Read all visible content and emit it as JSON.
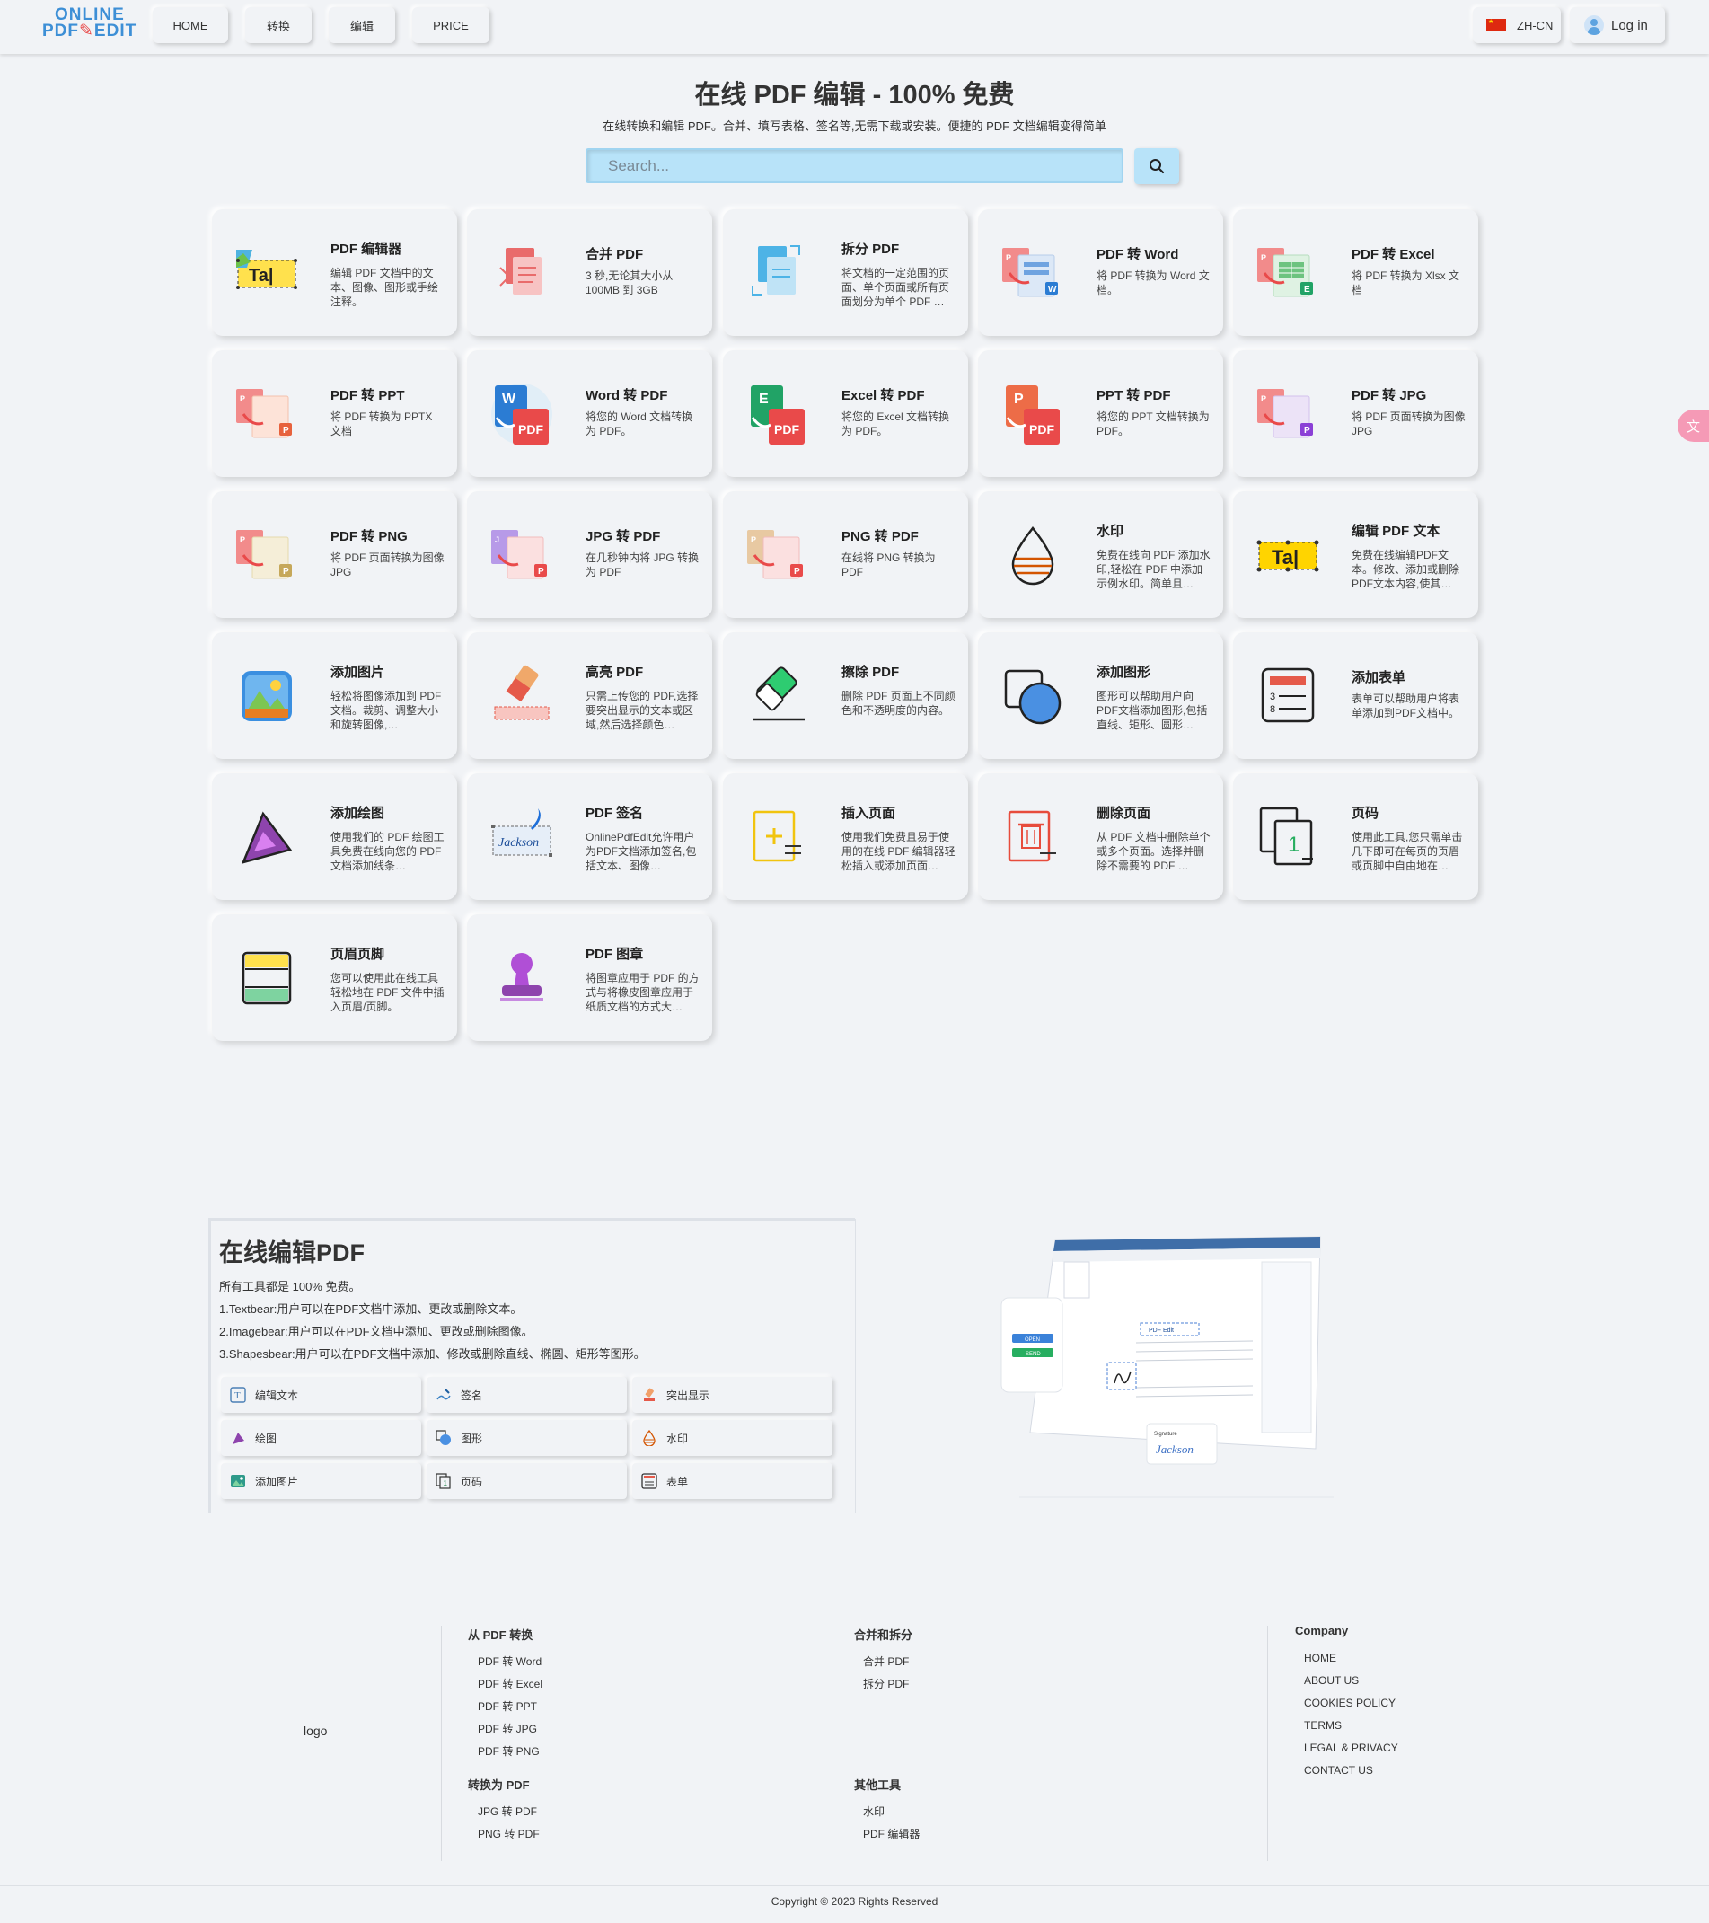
{
  "header": {
    "logo_top": "ONLINE",
    "logo_bottom": "PDF",
    "logo_bottom2": "EDIT",
    "nav": [
      "HOME",
      "转换",
      "编辑",
      "PRICE"
    ],
    "lang": "ZH-CN",
    "login": "Log in"
  },
  "hero": {
    "title": "在线 PDF 编辑 - 100% 免费",
    "subtitle": "在线转换和编辑 PDF。合并、填写表格、签名等,无需下载或安装。便捷的 PDF 文档编辑变得简单",
    "search_placeholder": "Search..."
  },
  "tools": [
    {
      "title": "PDF 编辑器",
      "desc": "编辑 PDF 文档中的文本、图像、图形或手绘注释。",
      "icon": "text-edit-icon"
    },
    {
      "title": "合并 PDF",
      "desc": "3 秒,无论其大小从 100MB 到 3GB",
      "icon": "merge-pdf-icon"
    },
    {
      "title": "拆分 PDF",
      "desc": "将文档的一定范围的页面、单个页面或所有页面划分为单个 PDF …",
      "icon": "split-pdf-icon"
    },
    {
      "title": "PDF 转 Word",
      "desc": "将 PDF 转换为 Word 文档。",
      "icon": "pdf-to-word-icon"
    },
    {
      "title": "PDF 转 Excel",
      "desc": "将 PDF 转换为 Xlsx 文档",
      "icon": "pdf-to-excel-icon"
    },
    {
      "title": "PDF 转 PPT",
      "desc": "将 PDF 转换为 PPTX 文档",
      "icon": "pdf-to-ppt-icon"
    },
    {
      "title": "Word 转 PDF",
      "desc": "将您的 Word 文档转换为 PDF。",
      "icon": "word-to-pdf-icon"
    },
    {
      "title": "Excel 转 PDF",
      "desc": "将您的 Excel 文档转换为 PDF。",
      "icon": "excel-to-pdf-icon"
    },
    {
      "title": "PPT 转 PDF",
      "desc": "将您的 PPT 文档转换为 PDF。",
      "icon": "ppt-to-pdf-icon"
    },
    {
      "title": "PDF 转 JPG",
      "desc": "将 PDF 页面转换为图像 JPG",
      "icon": "pdf-to-jpg-icon"
    },
    {
      "title": "PDF 转 PNG",
      "desc": "将 PDF 页面转换为图像 JPG",
      "icon": "pdf-to-png-icon"
    },
    {
      "title": "JPG 转 PDF",
      "desc": "在几秒钟内将 JPG 转换为 PDF",
      "icon": "jpg-to-pdf-icon"
    },
    {
      "title": "PNG 转 PDF",
      "desc": "在线将 PNG 转换为 PDF",
      "icon": "png-to-pdf-icon"
    },
    {
      "title": "水印",
      "desc": "免费在线向 PDF 添加水印,轻松在 PDF 中添加示例水印。简单且…",
      "icon": "watermark-icon"
    },
    {
      "title": "编辑 PDF 文本",
      "desc": "免费在线编辑PDF文本。修改、添加或删除PDF文本内容,使其…",
      "icon": "edit-text-icon"
    },
    {
      "title": "添加图片",
      "desc": "轻松将图像添加到 PDF 文档。裁剪、调整大小和旋转图像,…",
      "icon": "add-image-icon"
    },
    {
      "title": "高亮 PDF",
      "desc": "只需上传您的 PDF,选择要突出显示的文本或区域,然后选择颜色…",
      "icon": "highlight-icon"
    },
    {
      "title": "擦除 PDF",
      "desc": "删除 PDF 页面上不同颜色和不透明度的内容。",
      "icon": "eraser-icon"
    },
    {
      "title": "添加图形",
      "desc": "图形可以帮助用户向PDF文档添加图形,包括直线、矩形、圆形…",
      "icon": "shapes-icon"
    },
    {
      "title": "添加表单",
      "desc": "表单可以帮助用户将表单添加到PDF文档中。",
      "icon": "form-icon"
    },
    {
      "title": "添加绘图",
      "desc": "使用我们的 PDF 绘图工具免费在线向您的 PDF 文档添加线条…",
      "icon": "draw-icon"
    },
    {
      "title": "PDF 签名",
      "desc": "OnlinePdfEdit允许用户为PDF文档添加签名,包括文本、图像…",
      "icon": "signature-icon"
    },
    {
      "title": "插入页面",
      "desc": "使用我们免费且易于使用的在线 PDF 编辑器轻松插入或添加页面…",
      "icon": "insert-page-icon"
    },
    {
      "title": "删除页面",
      "desc": "从 PDF 文档中删除单个或多个页面。选择并删除不需要的 PDF …",
      "icon": "delete-page-icon"
    },
    {
      "title": "页码",
      "desc": "使用此工具,您只需单击几下即可在每页的页眉或页脚中自由地在…",
      "icon": "page-number-icon"
    },
    {
      "title": "页眉页脚",
      "desc": "您可以使用此在线工具轻松地在 PDF 文件中插入页眉/页脚。",
      "icon": "header-footer-icon"
    },
    {
      "title": "PDF 图章",
      "desc": "将图章应用于 PDF 的方式与将橡皮图章应用于纸质文档的方式大…",
      "icon": "stamp-icon"
    }
  ],
  "info": {
    "title": "在线编辑PDF",
    "lines": [
      "所有工具都是 100% 免费。",
      "1.Textbear:用户可以在PDF文档中添加、更改或删除文本。",
      "2.Imagebear:用户可以在PDF文档中添加、更改或删除图像。",
      "3.Shapesbear:用户可以在PDF文档中添加、修改或删除直线、椭圆、矩形等图形。"
    ],
    "buttons": [
      "编辑文本",
      "签名",
      "突出显示",
      "绘图",
      "图形",
      "水印",
      "添加图片",
      "页码",
      "表单"
    ]
  },
  "illustration": {
    "doc_title": "PDF Edit",
    "open": "OPEN",
    "send": "SEND",
    "signature_label": "Signature",
    "signature": "Jackson"
  },
  "footer": {
    "logo": "logo",
    "col1_title": "从 PDF 转换",
    "col1_links": [
      "PDF 转 Word",
      "PDF 转 Excel",
      "PDF 转 PPT",
      "PDF 转 JPG",
      "PDF 转 PNG"
    ],
    "col1b_title": "转换为 PDF",
    "col1b_links": [
      "JPG 转 PDF",
      "PNG 转 PDF"
    ],
    "col2_title": "合并和拆分",
    "col2_links": [
      "合并 PDF",
      "拆分 PDF"
    ],
    "col2b_title": "其他工具",
    "col2b_links": [
      "水印",
      "PDF 编辑器"
    ],
    "col3_title": "Company",
    "col3_links": [
      "HOME",
      "ABOUT US",
      "COOKIES POLICY",
      "TERMS",
      "LEGAL & PRIVACY",
      "CONTACT US"
    ],
    "copyright": "Copyright © 2023 Rights Reserved"
  },
  "side_tab": "文"
}
